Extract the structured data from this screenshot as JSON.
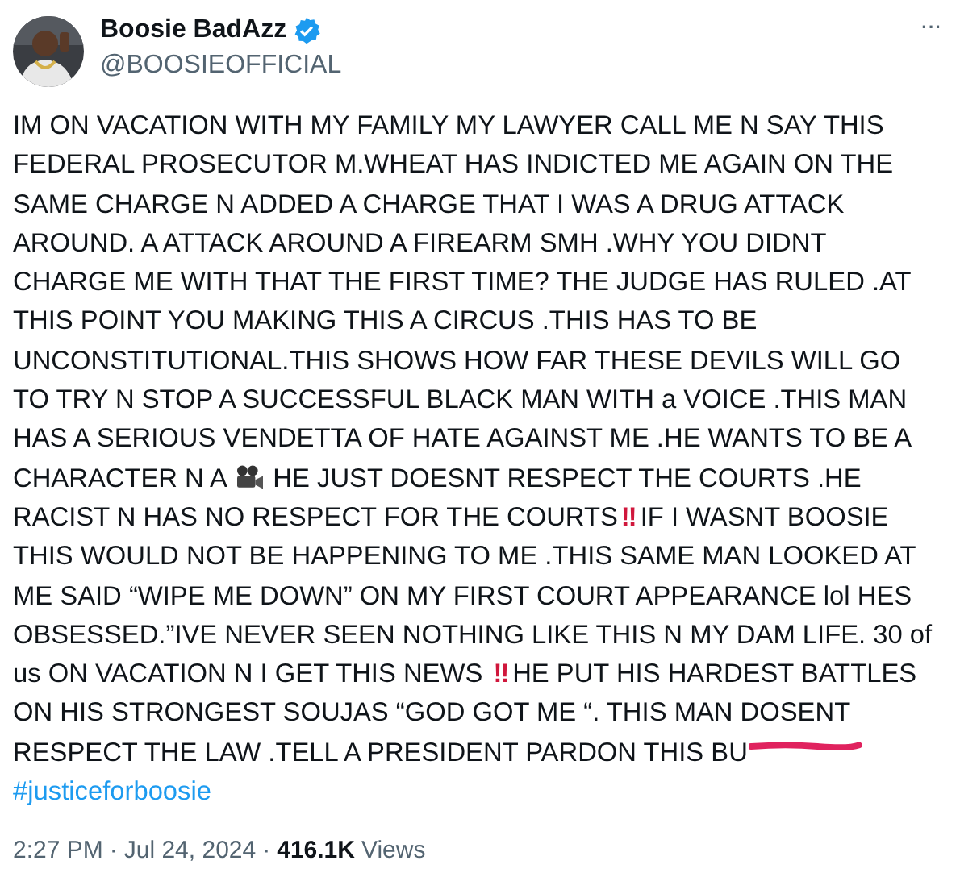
{
  "author": {
    "name": "Boosie BadAzz",
    "handle": "@BOOSIEOFFICIAL",
    "verified": true
  },
  "more_button": "···",
  "body_lines": [
    [
      {
        "kind": "text",
        "text": "IM ON VACATION WITH MY FAMILY MY LAWYER CALL ME N SAY THIS"
      }
    ],
    [
      {
        "kind": "text",
        "text": "FEDERAL PROSECUTOR M.WHEAT HAS INDICTED ME AGAIN ON THE"
      }
    ],
    [
      {
        "kind": "text",
        "text": "SAME CHARGE N ADDED A CHARGE THAT I WAS A DRUG ATTACK"
      }
    ],
    [
      {
        "kind": "text",
        "text": "AROUND. A ATTACK AROUND A FIREARM SMH .WHY YOU DIDNT"
      }
    ],
    [
      {
        "kind": "text",
        "text": "CHARGE ME WITH THAT THE FIRST TIME? THE JUDGE HAS  RULED .AT"
      }
    ],
    [
      {
        "kind": "text",
        "text": "THIS POINT YOU MAKING THIS A CIRCUS .THIS HAS TO BE"
      }
    ],
    [
      {
        "kind": "text",
        "text": "UNCONSTITUTIONAL.THIS SHOWS HOW FAR THESE DEVILS WILL GO"
      }
    ],
    [
      {
        "kind": "text",
        "text": "TO TRY N STOP A SUCCESSFUL BLACK MAN WITH a VOICE .THIS MAN"
      }
    ],
    [
      {
        "kind": "text",
        "text": "HAS A SERIOUS  VENDETTA OF HATE AGAINST ME .HE WANTS TO BE A"
      }
    ],
    [
      {
        "kind": "text",
        "text": "CHARACTER N A "
      },
      {
        "kind": "camera"
      },
      {
        "kind": "text",
        "text": " HE JUST DOESNT RESPECT THE COURTS .HE"
      }
    ],
    [
      {
        "kind": "text",
        "text": "RACIST N HAS NO RESPECT FOR THE COURTS"
      },
      {
        "kind": "alert",
        "text": "‼"
      },
      {
        "kind": "text",
        "text": "IF I WASNT BOOSIE"
      }
    ],
    [
      {
        "kind": "text",
        "text": "THIS WOULD NOT BE HAPPENING TO ME .THIS SAME MAN LOOKED AT"
      }
    ],
    [
      {
        "kind": "text",
        "text": "ME SAID “WIPE ME DOWN” ON MY FIRST COURT APPEARANCE lol HES"
      }
    ],
    [
      {
        "kind": "text",
        "text": "OBSESSED.”IVE NEVER SEEN NOTHING LIKE THIS N MY DAM LIFE. 30 of"
      }
    ],
    [
      {
        "kind": "text",
        "text": "us ON VACATION N I GET THIS NEWS "
      },
      {
        "kind": "alert",
        "text": "‼"
      },
      {
        "kind": "text",
        "text": "HE PUT HIS HARDEST BATTLES"
      }
    ],
    [
      {
        "kind": "text",
        "text": "ON HIS STRONGEST SOUJAS  “GOD GOT ME “. THIS MAN DOSENT"
      }
    ],
    [
      {
        "kind": "text",
        "text": "RESPECT THE LAW .TELL A PRESIDENT PARDON THIS BU"
      },
      {
        "kind": "scribble"
      }
    ]
  ],
  "hashtag": "#justiceforboosie",
  "time": "2:27 PM",
  "date": "Jul 24, 2024",
  "separators": [
    "·",
    "·"
  ],
  "views_count": "416.1K",
  "views_label": "Views"
}
